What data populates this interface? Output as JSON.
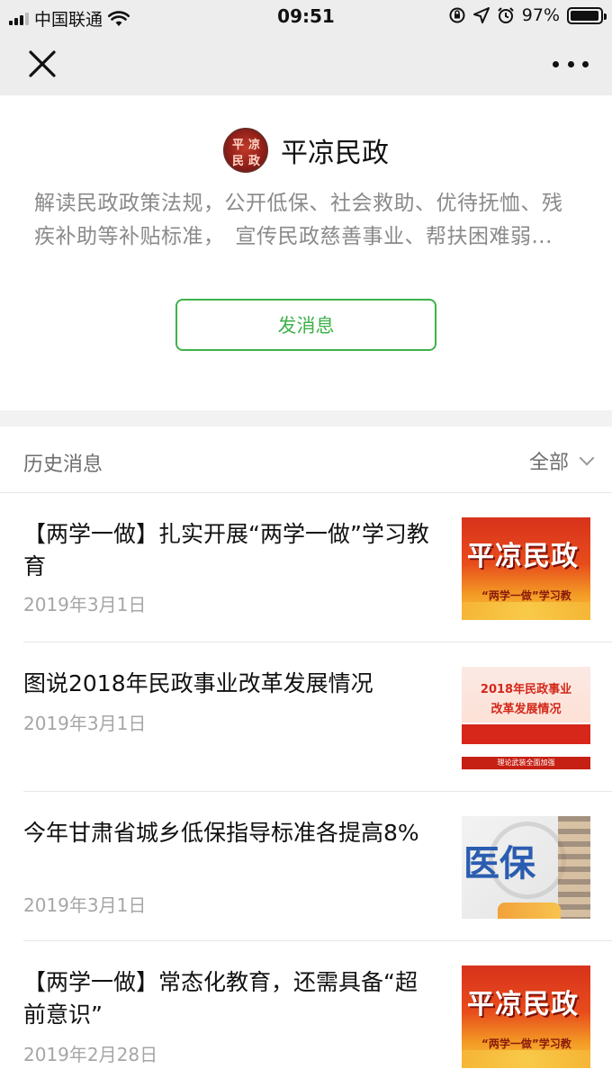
{
  "status_bar": {
    "carrier": "中国联通",
    "time": "09:51",
    "battery": "97%",
    "battery_level": 0.97
  },
  "nav": {
    "close_icon": "close-icon",
    "more_icon": "more-dots-icon"
  },
  "profile": {
    "avatar_text": [
      "平",
      "凉",
      "民",
      "政"
    ],
    "name": "平凉民政",
    "description": "解读民政政策法规，公开低保、社会救助、优待抚恤、残疾补助等补贴标准，　宣传民政慈善事业、帮扶困难弱...",
    "message_button": "发消息"
  },
  "history": {
    "title": "历史消息",
    "filter_label": "全部"
  },
  "articles": [
    {
      "title": "【两学一做】扎实开展“两学一做”学习教育",
      "date": "2019年3月1日",
      "thumb_title": "平凉民政",
      "thumb_sub": "“两学一做”学习教"
    },
    {
      "title": "图说2018年民政事业改革发展情况",
      "date": "2019年3月1日",
      "thumb_line1": "2018年民政事业",
      "thumb_line2": "改革发展情况",
      "thumb_slogan": "理论武装全面加强"
    },
    {
      "title": "今年甘肃省城乡低保指导标准各提高8%",
      "date": "2019年3月1日",
      "thumb_title": "医保"
    },
    {
      "title": "【两学一做】常态化教育，还需具备“超前意识”",
      "date": "2019年2月28日",
      "thumb_title": "平凉民政",
      "thumb_sub": "“两学一做”学习教"
    }
  ]
}
